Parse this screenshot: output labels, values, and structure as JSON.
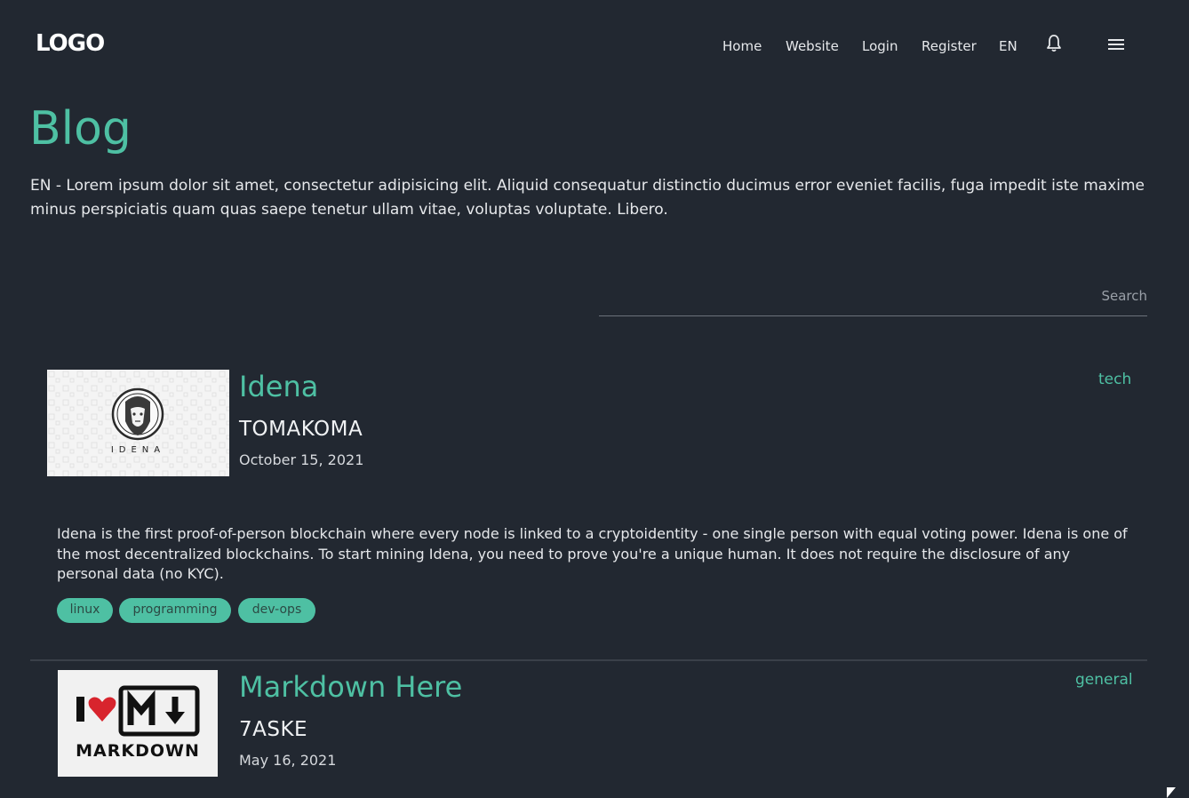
{
  "header": {
    "logo": "LOGO",
    "nav": [
      "Home",
      "Website",
      "Login",
      "Register",
      "EN"
    ],
    "bell_icon": "bell-icon",
    "menu_icon": "hamburger-menu-icon"
  },
  "page": {
    "title": "Blog",
    "intro": "EN - Lorem ipsum dolor sit amet, consectetur adipisicing elit. Aliquid consequatur distinctio ducimus error eveniet facilis, fuga impedit iste maxime minus perspiciatis quam quas saepe tenetur ullam vitae, voluptas voluptate. Libero."
  },
  "search": {
    "placeholder": "Search"
  },
  "posts": [
    {
      "title": "Idena",
      "author": "TOMAKOMA",
      "date": "October 15, 2021",
      "category": "tech",
      "thumb_text": "IDENA",
      "summary": "Idena is the first proof-of-person blockchain where every node is linked to a cryptoidentity - one single person with equal voting power. Idena is one of the most decentralized blockchains. To start mining Idena, you need to prove you're a unique human. It does not require the disclosure of any personal data (no KYC).",
      "tags": [
        "linux",
        "programming",
        "dev-ops"
      ]
    },
    {
      "title": "Markdown Here",
      "author": "7ASKE",
      "date": "May 16, 2021",
      "category": "general",
      "thumb_text": "MARKDOWN"
    }
  ],
  "colors": {
    "accent": "#4ec0a3",
    "background": "#222831"
  }
}
